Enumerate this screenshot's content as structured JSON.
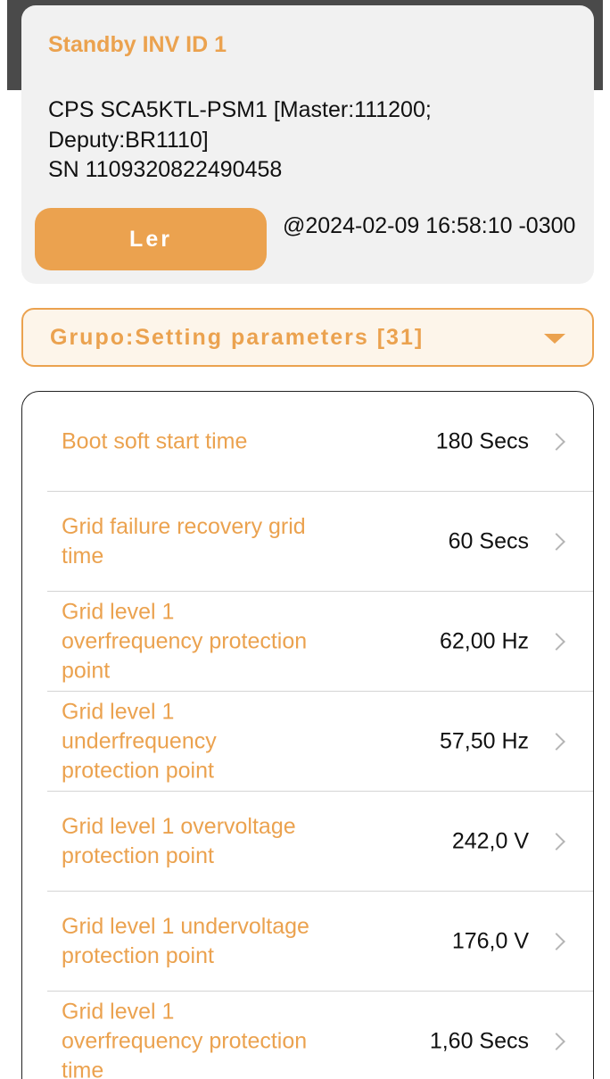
{
  "device": {
    "title": "Standby INV ID 1",
    "model": "CPS SCA5KTL-PSM1 [Master:111200; Deputy:BR1110]",
    "serial": "SN 1109320822490458",
    "read_label": "Ler",
    "read_time": "@2024-02-09 16:58:10 -0300"
  },
  "group": {
    "label": "Grupo:Setting parameters [31]"
  },
  "params": [
    {
      "label": "Boot soft start time",
      "value": "180 Secs"
    },
    {
      "label": "Grid failure recovery grid time",
      "value": "60 Secs"
    },
    {
      "label": "Grid level 1 overfrequency protection point",
      "value": "62,00 Hz"
    },
    {
      "label": "Grid level 1 underfrequency protection point",
      "value": "57,50 Hz"
    },
    {
      "label": "Grid level 1 overvoltage protection point",
      "value": "242,0 V"
    },
    {
      "label": "Grid level 1 undervoltage protection point",
      "value": "176,0 V"
    },
    {
      "label": "Grid level 1 overfrequency protection time",
      "value": "1,60 Secs"
    }
  ],
  "colors": {
    "accent": "#eba24f",
    "header_bar": "#4a4a4a",
    "card_bg": "#f1f1f1"
  }
}
